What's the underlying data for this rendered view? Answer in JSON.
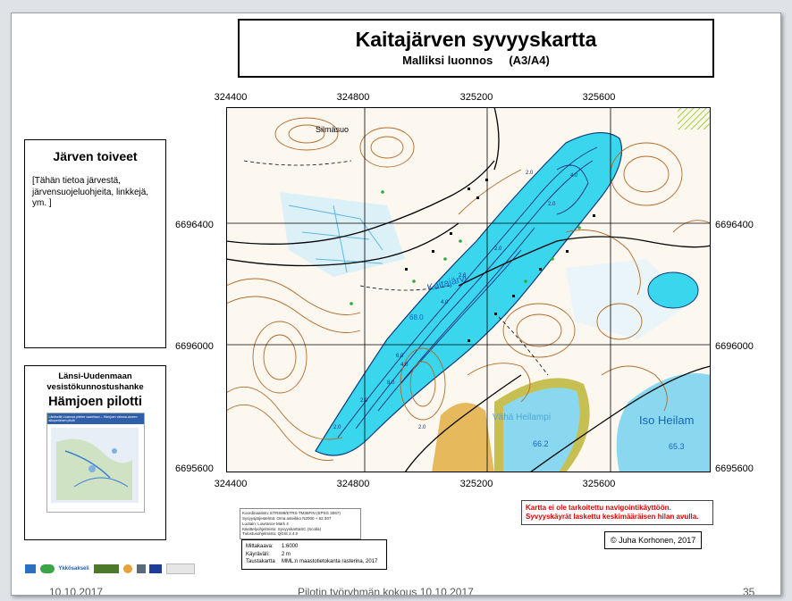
{
  "title": "Kaitajärven syvyyskartta",
  "subtitle": "Malliksi luonnos     (A3/A4)",
  "map": {
    "x_ticks": [
      "324400",
      "324800",
      "325200",
      "325600"
    ],
    "y_ticks": [
      "6696400",
      "6696000",
      "6695600"
    ],
    "labels": {
      "lake": "Kaitajärvi",
      "swamp": "Silmäsuo",
      "lake_level": "68.0",
      "small_lake": "Vähä Heilampi",
      "small_lake_level": "66.2",
      "big_lake": "Iso Heilam",
      "big_lake_level": "65.3"
    },
    "depth_labels": [
      "2.0",
      "2.0",
      "4.0",
      "2.0",
      "2.0",
      "4.0",
      "6.0",
      "8.0",
      "2.0",
      "2.0",
      "2.0",
      "4.0"
    ],
    "colors": {
      "water": "#39d6ee",
      "deep_line": "#1a2a7a",
      "contour": "#b36a2a",
      "road": "#000000",
      "field": "#e6b95c"
    }
  },
  "lake_panel": {
    "title": "Järven toiveet",
    "text": "[Tähän tietoa järvestä, järvensuojeluohjeita, linkkejä, ym. ]"
  },
  "project_panel": {
    "line1": "Länsi-Uudenmaan",
    "line2": "vesistökunnostushanke",
    "name": "Hämjoen pilotti",
    "thumb_caption": "Läntisellä Uusimaa pitelee saarelaan – Hämjoen valuma-alueen alkuperäinen pilotti"
  },
  "info_table": [
    [
      "Koordinaatisto:",
      "ETRS89/ETRS-TM35FIN (EPSG 3067)"
    ],
    [
      "Syvyysjärjestelmä:",
      "Oma asteikko N2000 + 62.307"
    ],
    [
      "Luotain:",
      "Lowrance Mark 4"
    ],
    [
      "Käsittelyohjelmisto:",
      "SyvyyskarttaSC (Scolla)"
    ],
    [
      "Tulostusohjelmisto:",
      "QGIS 2.4.0"
    ]
  ],
  "scale_box": {
    "scale_label": "Mittakaava:",
    "scale_value": "1:6000",
    "contour_label": "Käyrävälí:",
    "contour_value": "2 m",
    "basemap_label": "Taustakartta",
    "basemap_value": "MML:n maastotietokanta rasterina, 2017"
  },
  "warning": {
    "line1": "Kartta ei ole tarkoitettu navigointikäyttöön.",
    "line2": "Syvyyskäyrät laskettu keskimääräisen hilan avulla."
  },
  "copyright": "© Juha Korhonen, 2017",
  "logos": [
    "Ykkösakseli"
  ],
  "footer": {
    "date": "10.10.2017",
    "center": "Pilotin työryhmän kokous 10.10.2017",
    "page": "35"
  }
}
